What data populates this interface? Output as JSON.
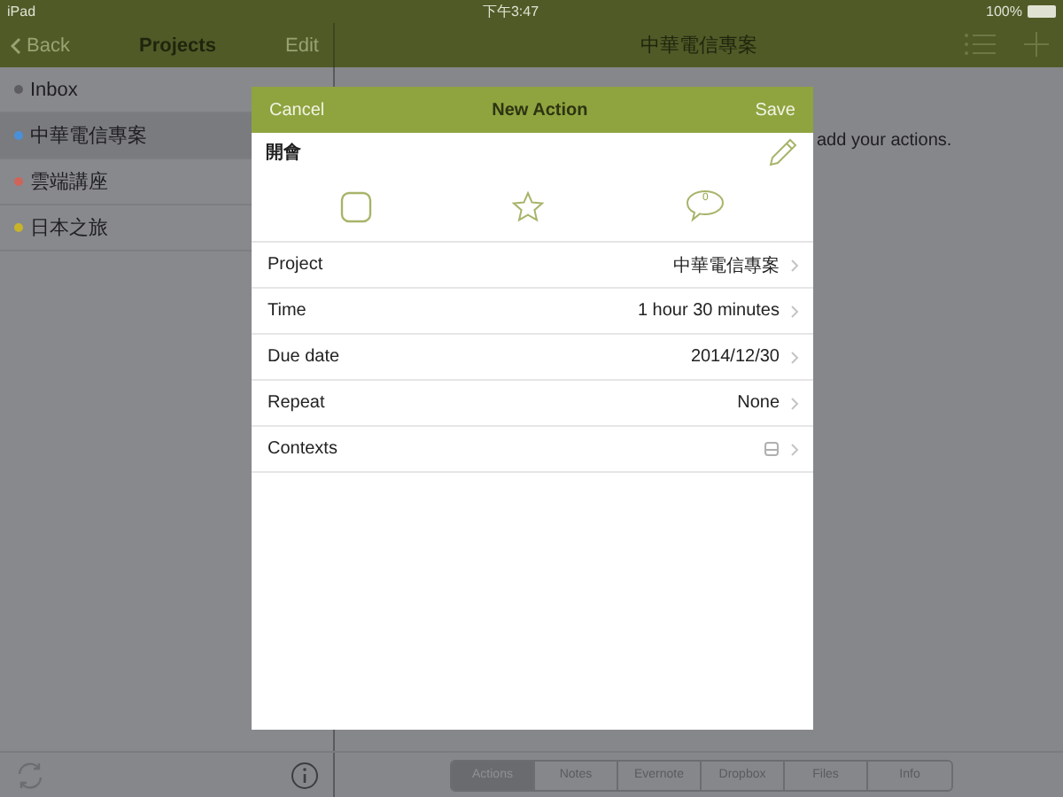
{
  "status_bar": {
    "device": "iPad",
    "time": "下午3:47",
    "battery": "100%"
  },
  "sidebar": {
    "back": "Back",
    "title": "Projects",
    "edit": "Edit",
    "items": [
      {
        "name": "Inbox",
        "color": "#5e5e62",
        "selected": false
      },
      {
        "name": "中華電信專案",
        "color": "#4a90d9",
        "selected": true
      },
      {
        "name": "雲端講座",
        "color": "#d0645a",
        "selected": false
      },
      {
        "name": "日本之旅",
        "color": "#c8b42a",
        "selected": false
      }
    ]
  },
  "main": {
    "title": "中華電信專案",
    "hint": "add your actions.",
    "tabs": [
      {
        "label": "Actions",
        "selected": true
      },
      {
        "label": "Notes",
        "selected": false
      },
      {
        "label": "Evernote",
        "selected": false
      },
      {
        "label": "Dropbox",
        "selected": false
      },
      {
        "label": "Files",
        "selected": false
      },
      {
        "label": "Info",
        "selected": false
      }
    ]
  },
  "dialog": {
    "cancel": "Cancel",
    "title": "New Action",
    "save": "Save",
    "action_name": "開會",
    "comment_count": "0",
    "rows": [
      {
        "label": "Project",
        "value": "中華電信專案"
      },
      {
        "label": "Time",
        "value": "1 hour 30 minutes"
      },
      {
        "label": "Due date",
        "value": "2014/12/30"
      },
      {
        "label": "Repeat",
        "value": "None"
      },
      {
        "label": "Contexts",
        "kind": "icon"
      }
    ]
  }
}
